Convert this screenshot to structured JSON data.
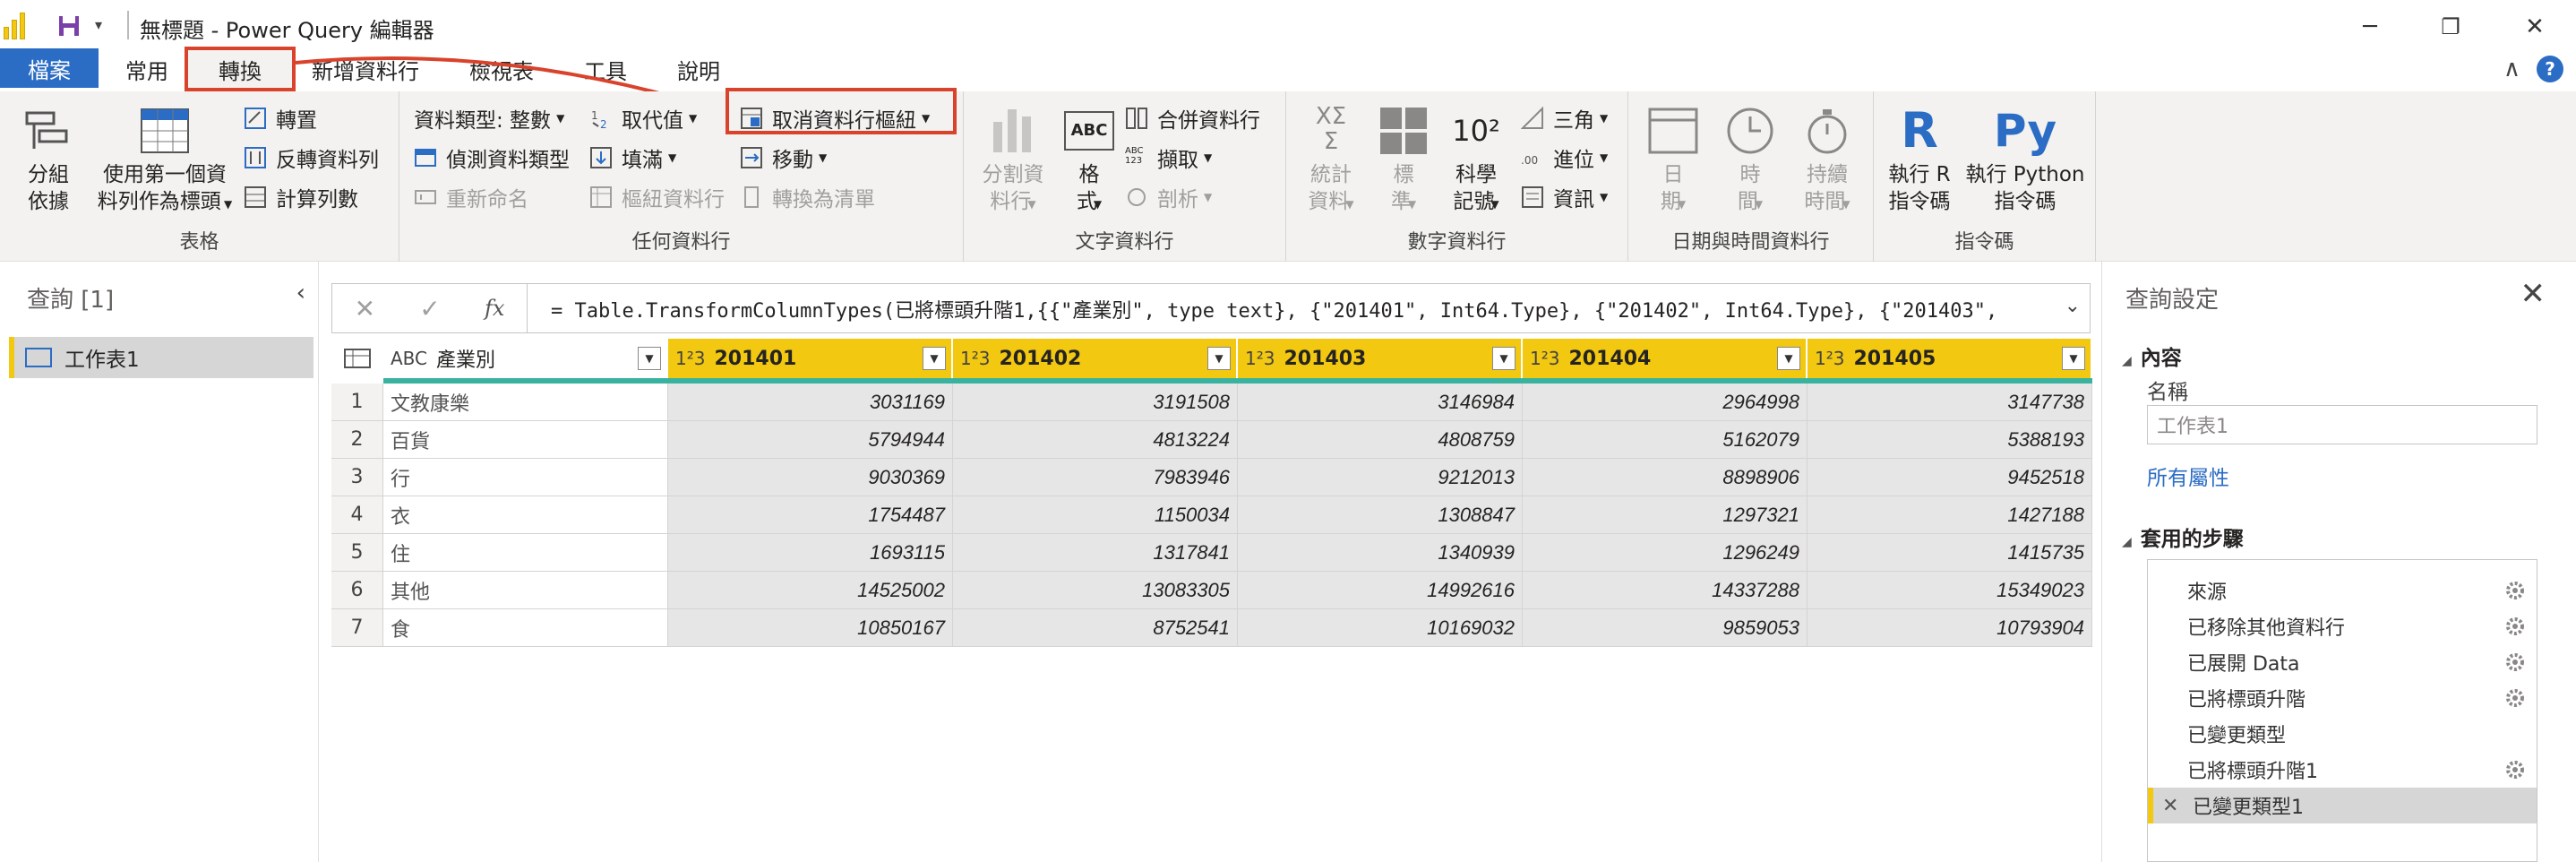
{
  "title_bar": {
    "title": "無標題 - Power Query 編輯器",
    "qa_dropdown": "▾",
    "minimize": "─",
    "restore": "❐",
    "close": "✕"
  },
  "tabs": [
    {
      "label": "檔案",
      "state": "file"
    },
    {
      "label": "常用",
      "state": ""
    },
    {
      "label": "轉換",
      "state": "active"
    },
    {
      "label": "新增資料行",
      "state": ""
    },
    {
      "label": "檢視表",
      "state": ""
    },
    {
      "label": "工具",
      "state": ""
    },
    {
      "label": "說明",
      "state": ""
    }
  ],
  "tabrow_right": {
    "collapse": "∧",
    "help": "?"
  },
  "ribbon": {
    "table_group": {
      "label": "表格",
      "group_by": {
        "line1": "分組",
        "line2": "依據"
      },
      "use_first_row": {
        "line1": "使用第一個資",
        "line2": "料列作為標頭"
      },
      "transpose": "轉置",
      "reverse_rows": "反轉資料列",
      "count_rows": "計算列數"
    },
    "any_column_group": {
      "label": "任何資料行",
      "data_type": "資料類型: 整數",
      "detect_type": "偵測資料類型",
      "rename": "重新命名",
      "replace_values": "取代值",
      "fill": "填滿",
      "pivot_column": "樞紐資料行",
      "unpivot_columns": "取消資料行樞紐",
      "move": "移動",
      "convert_to_list": "轉換為清單"
    },
    "text_column_group": {
      "label": "文字資料行",
      "split_column": {
        "line1": "分割資",
        "line2": "料行"
      },
      "format": {
        "line1": "格",
        "line2": "式"
      },
      "merge_columns": "合併資料行",
      "extract": "擷取",
      "parse": "剖析",
      "abc_icon": "ABC",
      "abc123_icon": "ABC\n123"
    },
    "number_column_group": {
      "label": "數字資料行",
      "statistics": {
        "line1": "統計",
        "line2": "資料"
      },
      "standard": {
        "line1": "標",
        "line2": "準"
      },
      "scientific": {
        "line1": "科學",
        "line2": "記號"
      },
      "trig": "三角",
      "rounding": "進位",
      "information": "資訊",
      "sigma_icon": "XΣ\nΣ",
      "sci_icon": "10²"
    },
    "datetime_column_group": {
      "label": "日期與時間資料行",
      "date": {
        "line1": "日",
        "line2": "期"
      },
      "time": {
        "line1": "時",
        "line2": "間"
      },
      "duration": {
        "line1": "持續",
        "line2": "時間"
      }
    },
    "scripts_group": {
      "label": "指令碼",
      "run_r": {
        "line1": "執行 R",
        "line2": "指令碼",
        "icon": "R"
      },
      "run_python": {
        "line1": "執行 Python",
        "line2": "指令碼",
        "icon": "Py"
      }
    }
  },
  "queries_pane": {
    "header": "查詢 [1]",
    "collapse": "‹",
    "items": [
      {
        "label": "工作表1"
      }
    ]
  },
  "formula_bar": {
    "cancel": "✕",
    "commit": "✓",
    "fx": "fx",
    "expand": "⌄",
    "formula": "= Table.TransformColumnTypes(已將標頭升階1,{{\"產業別\", type text}, {\"201401\", Int64.Type}, {\"201402\", Int64.Type}, {\"201403\","
  },
  "grid": {
    "columns": [
      {
        "name": "產業別",
        "type_icon": "ABC",
        "kind": "text"
      },
      {
        "name": "201401",
        "type_icon": "1²3",
        "kind": "num"
      },
      {
        "name": "201402",
        "type_icon": "1²3",
        "kind": "num"
      },
      {
        "name": "201403",
        "type_icon": "1²3",
        "kind": "num"
      },
      {
        "name": "201404",
        "type_icon": "1²3",
        "kind": "num"
      },
      {
        "name": "201405",
        "type_icon": "1²3",
        "kind": "num"
      }
    ],
    "rows": [
      [
        "1",
        "文教康樂",
        "3031169",
        "3191508",
        "3146984",
        "2964998",
        "3147738"
      ],
      [
        "2",
        "百貨",
        "5794944",
        "4813224",
        "4808759",
        "5162079",
        "5388193"
      ],
      [
        "3",
        "行",
        "9030369",
        "7983946",
        "9212013",
        "8898906",
        "9452518"
      ],
      [
        "4",
        "衣",
        "1754487",
        "1150034",
        "1308847",
        "1297321",
        "1427188"
      ],
      [
        "5",
        "住",
        "1693115",
        "1317841",
        "1340939",
        "1296249",
        "1415735"
      ],
      [
        "6",
        "其他",
        "14525002",
        "13083305",
        "14992616",
        "14337288",
        "15349023"
      ],
      [
        "7",
        "食",
        "10850167",
        "8752541",
        "10169032",
        "9859053",
        "10793904"
      ]
    ]
  },
  "settings_pane": {
    "title": "查詢設定",
    "close": "✕",
    "properties_header": "內容",
    "name_label": "名稱",
    "name_value": "工作表1",
    "all_properties": "所有屬性",
    "steps_header": "套用的步驟",
    "steps": [
      {
        "label": "來源",
        "gear": true,
        "selected": false
      },
      {
        "label": "已移除其他資料行",
        "gear": true,
        "selected": false
      },
      {
        "label": "已展開 Data",
        "gear": true,
        "selected": false
      },
      {
        "label": "已將標頭升階",
        "gear": true,
        "selected": false
      },
      {
        "label": "已變更類型",
        "gear": false,
        "selected": false
      },
      {
        "label": "已將標頭升階1",
        "gear": true,
        "selected": false
      },
      {
        "label": "已變更類型1",
        "gear": false,
        "selected": true
      }
    ],
    "selected_step_delete": "✕"
  },
  "colors": {
    "accent": "#2b6cc4",
    "highlight": "#d9422b",
    "header_yellow": "#f2c811",
    "quality_bar": "#3ab2a0"
  }
}
